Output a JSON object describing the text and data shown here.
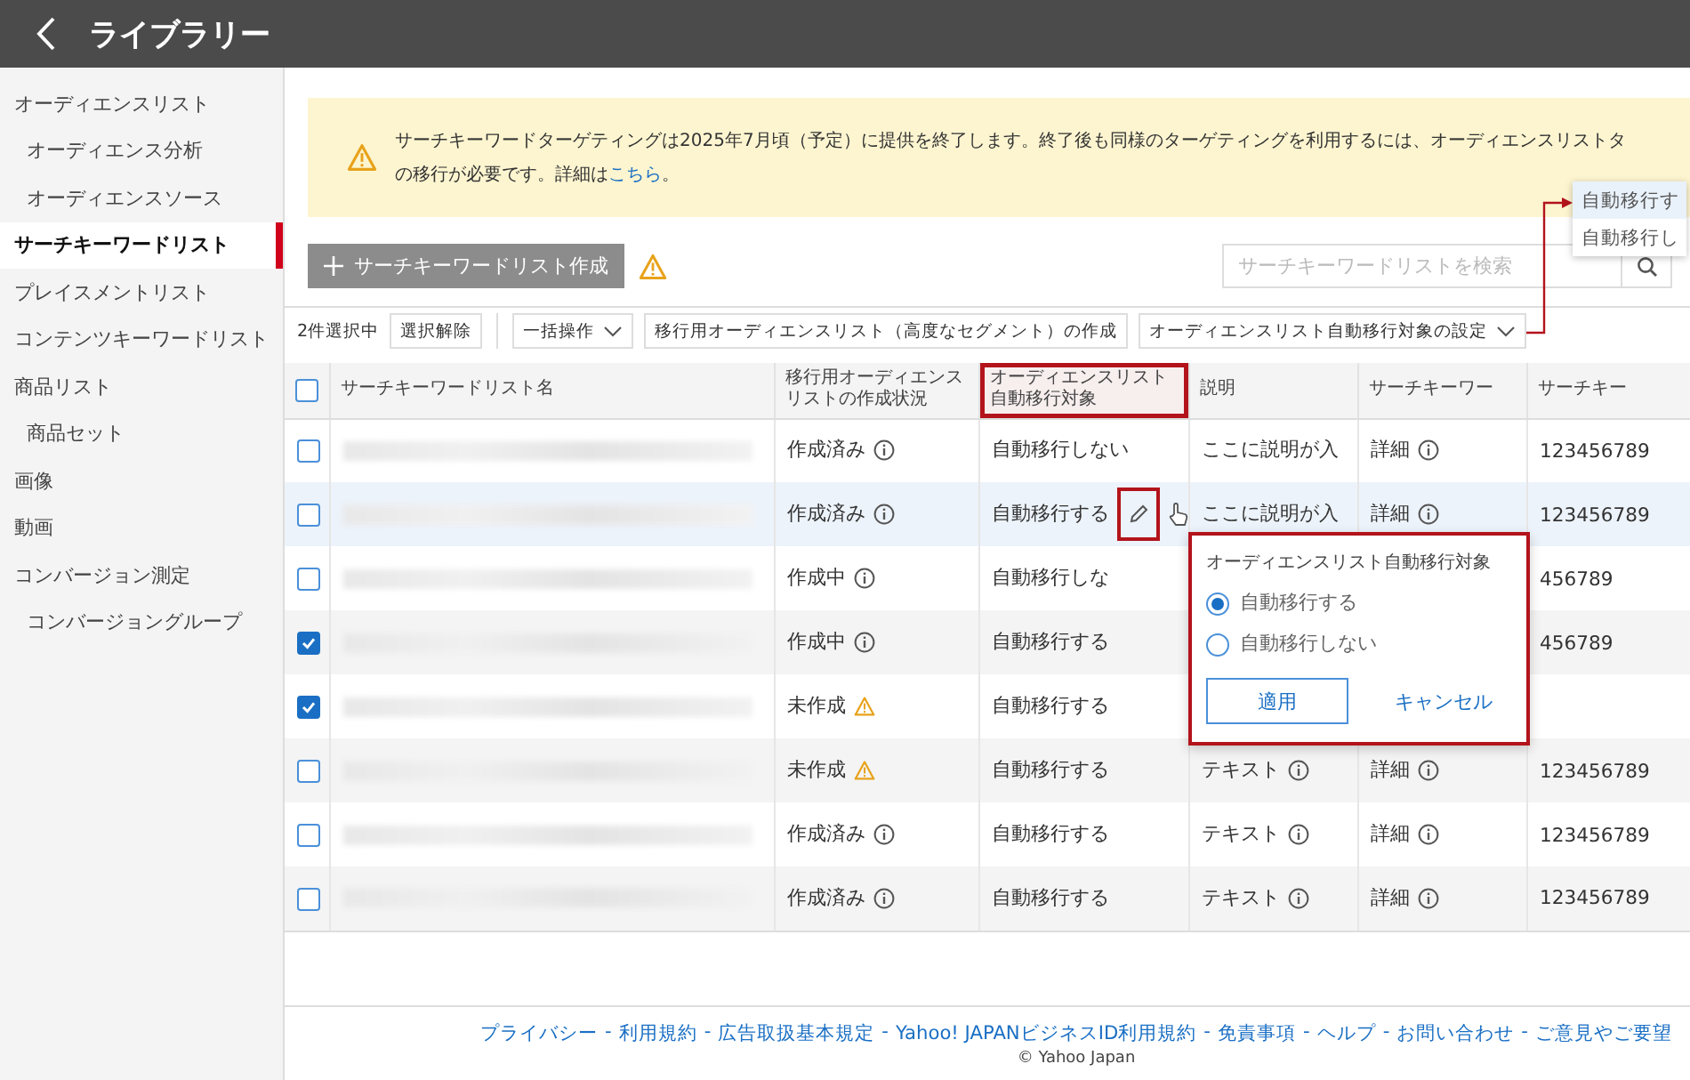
{
  "header": {
    "title": "ライブラリー"
  },
  "sidebar": {
    "items": [
      {
        "label": "オーディエンスリスト",
        "selected": false,
        "children": [
          {
            "label": "オーディエンス分析",
            "selected": false
          },
          {
            "label": "オーディエンスソース",
            "selected": false
          }
        ]
      },
      {
        "label": "サーチキーワードリスト",
        "selected": true
      },
      {
        "label": "プレイスメントリスト",
        "selected": false
      },
      {
        "label": "コンテンツキーワードリスト",
        "selected": false
      },
      {
        "label": "商品リスト",
        "selected": false,
        "children": [
          {
            "label": "商品セット",
            "selected": false
          }
        ]
      },
      {
        "label": "画像",
        "selected": false
      },
      {
        "label": "動画",
        "selected": false
      },
      {
        "label": "コンバージョン測定",
        "selected": false,
        "children": [
          {
            "label": "コンバージョングループ",
            "selected": false
          }
        ]
      }
    ]
  },
  "notice": {
    "line_1": "サーチキーワードターゲティングは2025年7月頃（予定）に提供を終了します。終了後も同様のターゲティングを利用するには、オーディエンスリストタ",
    "line_2": "の移行が必要です。詳細は",
    "link": "こちら",
    "end": "。"
  },
  "toolbar": {
    "create_button": "サーチキーワードリスト作成",
    "search": {
      "placeholder": "サーチキーワードリストを検索"
    }
  },
  "dropdown_menu": {
    "items": [
      {
        "label": "自動移行す",
        "selected": true
      },
      {
        "label": "自動移行し",
        "selected": false
      }
    ]
  },
  "selection_bar": {
    "count": "2件選択中",
    "clear_button": "選択解除",
    "bulk_button": "一括操作",
    "create_audience_button": "移行用オーディエンスリスト（高度なセグメント）の作成",
    "auto_migration_button": "オーディエンスリスト自動移行対象の設定"
  },
  "table": {
    "select_all": {
      "checked": false
    },
    "columns": [
      {
        "label": "サーチキーワードリスト名",
        "highlighted": false
      },
      {
        "label": "移行用オーディエンスリストの作成状況",
        "highlighted": false
      },
      {
        "label": "オーディエンスリスト自動移行対象",
        "highlighted": true
      },
      {
        "label": "説明",
        "highlighted": false
      },
      {
        "label": "サーチキーワー",
        "highlighted": false
      },
      {
        "label": "サーチキー",
        "highlighted": false
      }
    ],
    "rows": [
      {
        "checked": false,
        "hovered": false,
        "status": {
          "text": "作成済み",
          "kind": "info"
        },
        "auto_target": {
          "text": "自動移行しない",
          "edit_icon": false
        },
        "description": {
          "text": "ここに説明が入",
          "icon": false
        },
        "keywords": "詳細",
        "column_6": "123456789"
      },
      {
        "checked": false,
        "hovered": true,
        "status": {
          "text": "作成済み",
          "kind": "info"
        },
        "auto_target": {
          "text": "自動移行する",
          "edit_icon": true
        },
        "description": {
          "text": "ここに説明が入",
          "icon": false
        },
        "keywords": "詳細",
        "column_6": "123456789"
      },
      {
        "checked": false,
        "hovered": false,
        "status": {
          "text": "作成中",
          "kind": "info"
        },
        "auto_target": {
          "text": "自動移行しな",
          "edit_icon": false
        },
        "column_6": "456789"
      },
      {
        "checked": true,
        "hovered": false,
        "status": {
          "text": "作成中",
          "kind": "info"
        },
        "auto_target": {
          "text": "自動移行する",
          "edit_icon": false
        },
        "column_6": "456789"
      },
      {
        "checked": true,
        "hovered": false,
        "status": {
          "text": "未作成",
          "kind": "warning"
        },
        "auto_target": {
          "text": "自動移行する",
          "edit_icon": false
        }
      },
      {
        "checked": false,
        "hovered": false,
        "status": {
          "text": "未作成",
          "kind": "warning"
        },
        "auto_target": {
          "text": "自動移行する",
          "edit_icon": false
        },
        "description": {
          "text": "テキスト",
          "icon": true
        },
        "keywords": "詳細",
        "column_6": "123456789"
      },
      {
        "checked": false,
        "hovered": false,
        "status": {
          "text": "作成済み",
          "kind": "info"
        },
        "auto_target": {
          "text": "自動移行する",
          "edit_icon": false
        },
        "description": {
          "text": "テキスト",
          "icon": true
        },
        "keywords": "詳細",
        "column_6": "123456789"
      },
      {
        "checked": false,
        "hovered": false,
        "status": {
          "text": "作成済み",
          "kind": "info"
        },
        "auto_target": {
          "text": "自動移行する",
          "edit_icon": false
        },
        "description": {
          "text": "テキスト",
          "icon": true
        },
        "keywords": "詳細",
        "column_6": "123456789"
      }
    ]
  },
  "popup": {
    "title": "オーディエンスリスト自動移行対象",
    "options": [
      {
        "label": "自動移行する",
        "selected": true
      },
      {
        "label": "自動移行しない",
        "selected": false
      }
    ],
    "apply_button": "適用",
    "cancel_button": "キャンセル"
  },
  "footer": {
    "links": [
      "プライバシー",
      "利用規約",
      "広告取扱基本規定",
      "Yahoo! JAPANビジネスID利用規約",
      "免責事項",
      "ヘルプ",
      "お問い合わせ",
      "ご意見やご要望"
    ],
    "separator": "-",
    "copyright": "© Yahoo Japan"
  }
}
